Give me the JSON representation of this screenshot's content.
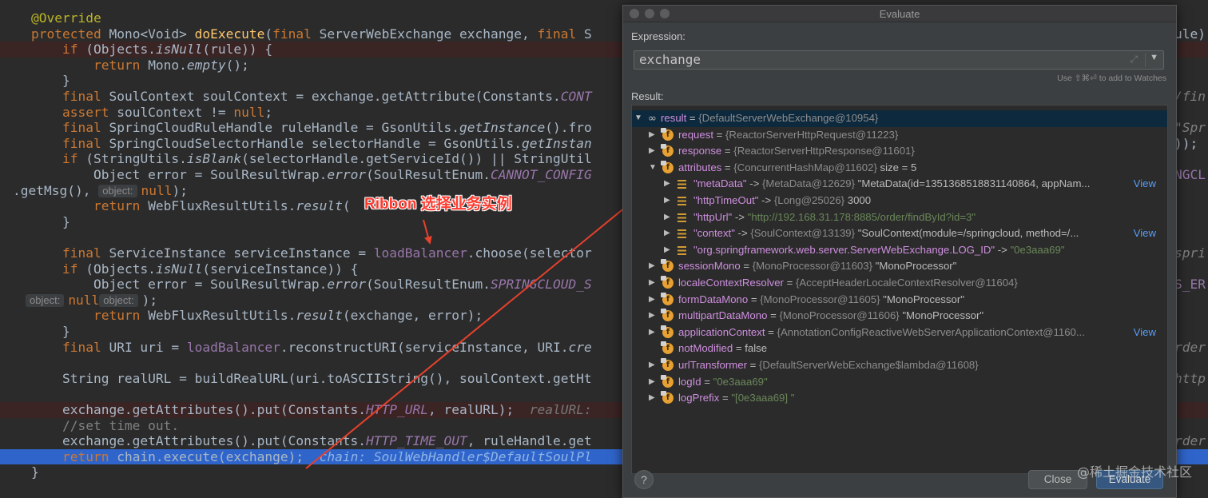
{
  "editor": {
    "lines": [
      {
        "segs": [
          [
            "    ",
            ""
          ],
          [
            "@Override",
            "a"
          ]
        ]
      },
      {
        "segs": [
          [
            "    ",
            ""
          ],
          [
            "protected ",
            "k"
          ],
          [
            "Mono<Void> ",
            ""
          ],
          [
            "doExecute",
            "m"
          ],
          [
            "(",
            ""
          ],
          [
            "final ",
            "k"
          ],
          [
            "ServerWebExchange exchange, ",
            ""
          ],
          [
            "final ",
            "k"
          ],
          [
            "S",
            ""
          ]
        ],
        "ghost": "ule)",
        "ghostCls": "n"
      },
      {
        "err": true,
        "segs": [
          [
            "        ",
            ""
          ],
          [
            "if ",
            "k"
          ],
          [
            "(Objects.",
            ""
          ],
          [
            "isNull",
            "i"
          ],
          [
            "(rule)) {",
            ""
          ]
        ]
      },
      {
        "segs": [
          [
            "            ",
            ""
          ],
          [
            "return ",
            "k"
          ],
          [
            "Mono.",
            ""
          ],
          [
            "empty",
            "i"
          ],
          [
            "();",
            ""
          ]
        ]
      },
      {
        "segs": [
          [
            "        }",
            ""
          ]
        ]
      },
      {
        "segs": [
          [
            "        ",
            ""
          ],
          [
            "final ",
            "k"
          ],
          [
            "SoulContext soulContext = exchange.getAttribute(Constants.",
            ""
          ],
          [
            "CONT",
            "c"
          ]
        ],
        "ghost": "/fin"
      },
      {
        "segs": [
          [
            "        ",
            ""
          ],
          [
            "assert ",
            "k"
          ],
          [
            "soulContext != ",
            ""
          ],
          [
            "null",
            "k"
          ],
          [
            ";",
            ""
          ]
        ]
      },
      {
        "segs": [
          [
            "        ",
            ""
          ],
          [
            "final ",
            "k"
          ],
          [
            "SpringCloudRuleHandle ruleHandle = GsonUtils.",
            ""
          ],
          [
            "getInstance",
            "i"
          ],
          [
            "().fro",
            ""
          ]
        ],
        "ghost": "\"Spr"
      },
      {
        "segs": [
          [
            "        ",
            ""
          ],
          [
            "final ",
            "k"
          ],
          [
            "SpringCloudSelectorHandle selectorHandle = GsonUtils.",
            ""
          ],
          [
            "getInstan",
            "i"
          ]
        ],
        "ghost": "));",
        "ghostCls": "n"
      },
      {
        "segs": [
          [
            "        ",
            ""
          ],
          [
            "if ",
            "k"
          ],
          [
            "(StringUtils.",
            ""
          ],
          [
            "isBlank",
            "i"
          ],
          [
            "(selectorHandle.getServiceId()) || StringUtil",
            ""
          ]
        ]
      },
      {
        "segs": [
          [
            "            Object error = SoulResultWrap.",
            ""
          ],
          [
            "error",
            "i"
          ],
          [
            "(SoulResultEnum.",
            ""
          ],
          [
            "CANNOT_CONFIG",
            "c"
          ]
        ],
        "ghost": "NGCL",
        "ghostCls": "cv"
      },
      {
        "chipLine": true,
        "segs": [
          [
            ".getMsg(), ",
            ""
          ],
          [
            "null",
            "k"
          ],
          [
            ");",
            ""
          ]
        ],
        "chip": "object:"
      },
      {
        "segs": [
          [
            "            ",
            ""
          ],
          [
            "return ",
            "k"
          ],
          [
            "WebFluxResultUtils.",
            ""
          ],
          [
            "result",
            "i"
          ],
          [
            "(",
            ""
          ]
        ]
      },
      {
        "segs": [
          [
            "        }",
            ""
          ]
        ]
      },
      {
        "segs": [
          [
            "",
            ""
          ]
        ]
      },
      {
        "segs": [
          [
            "        ",
            ""
          ],
          [
            "final ",
            "k"
          ],
          [
            "ServiceInstance serviceInstance = ",
            ""
          ],
          [
            "loadBalancer",
            "f"
          ],
          [
            ".choose(selector",
            ""
          ]
        ],
        "ghost": "spri"
      },
      {
        "segs": [
          [
            "        ",
            ""
          ],
          [
            "if ",
            "k"
          ],
          [
            "(Objects.",
            ""
          ],
          [
            "isNull",
            "i"
          ],
          [
            "(serviceInstance)) {",
            ""
          ]
        ]
      },
      {
        "segs": [
          [
            "            Object error = SoulResultWrap.",
            ""
          ],
          [
            "error",
            "i"
          ],
          [
            "(SoulResultEnum.",
            ""
          ],
          [
            "SPRINGCLOUD_S",
            "c"
          ]
        ],
        "ghost": "S_ER",
        "ghostCls": "cv"
      },
      {
        "chipLine": true,
        "segs": [
          [
            "null",
            "k"
          ],
          [
            ");",
            ""
          ]
        ],
        "chip": "object:"
      },
      {
        "segs": [
          [
            "            ",
            ""
          ],
          [
            "return ",
            "k"
          ],
          [
            "WebFluxResultUtils.",
            ""
          ],
          [
            "result",
            "i"
          ],
          [
            "(exchange, error);",
            ""
          ]
        ]
      },
      {
        "segs": [
          [
            "        }",
            ""
          ]
        ]
      },
      {
        "segs": [
          [
            "        ",
            ""
          ],
          [
            "final ",
            "k"
          ],
          [
            "URI uri = ",
            ""
          ],
          [
            "loadBalancer",
            "f"
          ],
          [
            ".reconstructURI(serviceInstance, URI.",
            ""
          ],
          [
            "cre",
            "i"
          ]
        ],
        "ghost": "rder"
      },
      {
        "segs": [
          [
            "",
            ""
          ]
        ]
      },
      {
        "segs": [
          [
            "        String realURL = buildRealURL(uri.toASCIIString(), soulContext.getHt",
            ""
          ]
        ],
        "ghost": "http"
      },
      {
        "segs": [
          [
            "",
            ""
          ]
        ]
      },
      {
        "err": true,
        "segs": [
          [
            "        exchange.getAttributes().put(Constants.",
            ""
          ],
          [
            "HTTP_URL",
            "c"
          ],
          [
            ", realURL);  ",
            ""
          ],
          [
            "realURL:",
            "h"
          ]
        ]
      },
      {
        "segs": [
          [
            "        ",
            ""
          ],
          [
            "//set time out.",
            "g"
          ]
        ]
      },
      {
        "segs": [
          [
            "        exchange.getAttributes().put(Constants.",
            ""
          ],
          [
            "HTTP_TIME_OUT",
            "c"
          ],
          [
            ", ruleHandle.get",
            ""
          ]
        ],
        "ghost": "rder"
      },
      {
        "cur": true,
        "segs": [
          [
            "        ",
            ""
          ],
          [
            "return ",
            "k"
          ],
          [
            "chain.execute(exchange);  ",
            ""
          ],
          [
            "chain: SoulWebHandler$DefaultSoulPl",
            "hc"
          ]
        ]
      },
      {
        "segs": [
          [
            "    }",
            ""
          ]
        ]
      }
    ]
  },
  "annotation": {
    "text": "Ribbon 选择业务实例"
  },
  "dialog": {
    "title": "Evaluate",
    "expression_label": "Expression:",
    "expression_value": "exchange",
    "watch_hint": "Use ⇧⌘⏎ to add to Watches",
    "result_label": "Result:",
    "tree": [
      {
        "level": 0,
        "open": true,
        "icon": "watch",
        "name": "result",
        "op": " = ",
        "val": "{DefaultServerWebExchange@10954}",
        "sel": true
      },
      {
        "level": 1,
        "arrow": true,
        "icon": "field",
        "name": "request",
        "op": " = ",
        "val": "{ReactorServerHttpRequest@11223}"
      },
      {
        "level": 1,
        "arrow": true,
        "icon": "field",
        "name": "response",
        "op": " = ",
        "val": "{ReactorServerHttpResponse@11601}"
      },
      {
        "level": 1,
        "open": true,
        "icon": "field",
        "name": "attributes",
        "op": " = ",
        "val": "{ConcurrentHashMap@11602}",
        "extra": "  size = 5"
      },
      {
        "level": 2,
        "arrow": true,
        "icon": "entry",
        "name": "\"metaData\"",
        "op": " -> ",
        "val": "{MetaData@12629}",
        "extra": " \"MetaData(id=1351368518831140864, appNam...",
        "view": "View"
      },
      {
        "level": 2,
        "arrow": true,
        "icon": "entry",
        "name": "\"httpTimeOut\"",
        "op": " -> ",
        "val": "{Long@25026}",
        "extra": " 3000"
      },
      {
        "level": 2,
        "arrow": true,
        "icon": "entry",
        "name": "\"httpUrl\"",
        "op": " -> ",
        "sval": "\"http://192.168.31.178:8885/order/findById?id=3\""
      },
      {
        "level": 2,
        "arrow": true,
        "icon": "entry",
        "name": "\"context\"",
        "op": " -> ",
        "val": "{SoulContext@13139}",
        "extra": " \"SoulContext(module=/springcloud, method=/...",
        "view": "View"
      },
      {
        "level": 2,
        "arrow": true,
        "icon": "entry",
        "name": "\"org.springframework.web.server.ServerWebExchange.LOG_ID\"",
        "op": " -> ",
        "sval": "\"0e3aaa69\""
      },
      {
        "level": 1,
        "arrow": true,
        "icon": "field",
        "name": "sessionMono",
        "op": " = ",
        "val": "{MonoProcessor@11603}",
        "extra": " \"MonoProcessor\""
      },
      {
        "level": 1,
        "arrow": true,
        "icon": "field",
        "name": "localeContextResolver",
        "op": " = ",
        "val": "{AcceptHeaderLocaleContextResolver@11604}"
      },
      {
        "level": 1,
        "arrow": true,
        "icon": "field",
        "name": "formDataMono",
        "op": " = ",
        "val": "{MonoProcessor@11605}",
        "extra": " \"MonoProcessor\""
      },
      {
        "level": 1,
        "arrow": true,
        "icon": "field",
        "name": "multipartDataMono",
        "op": " = ",
        "val": "{MonoProcessor@11606}",
        "extra": " \"MonoProcessor\""
      },
      {
        "level": 1,
        "arrow": true,
        "icon": "field",
        "name": "applicationContext",
        "op": " = ",
        "val": "{AnnotationConfigReactiveWebServerApplicationContext@1160...",
        "view": "View"
      },
      {
        "level": 1,
        "arrow": false,
        "icon": "field",
        "name": "notModified",
        "op": " = ",
        "extra": "false"
      },
      {
        "level": 1,
        "arrow": true,
        "icon": "field",
        "name": "urlTransformer",
        "op": " = ",
        "val": "{DefaultServerWebExchange$lambda@11608}"
      },
      {
        "level": 1,
        "arrow": true,
        "icon": "field",
        "name": "logId",
        "op": " = ",
        "sval": "\"0e3aaa69\""
      },
      {
        "level": 1,
        "arrow": true,
        "icon": "field",
        "name": "logPrefix",
        "op": " = ",
        "sval": "\"[0e3aaa69] \""
      }
    ],
    "help_label": "?",
    "close_label": "Close",
    "evaluate_label": "Evaluate"
  },
  "watermark": "@稀土掘金技术社区",
  "colors": {
    "keyword": "#cc7832",
    "string": "#6a8759",
    "field": "#9876aa",
    "selection": "#2f65ca",
    "arrow": "#e8412c",
    "link": "#589df6"
  }
}
